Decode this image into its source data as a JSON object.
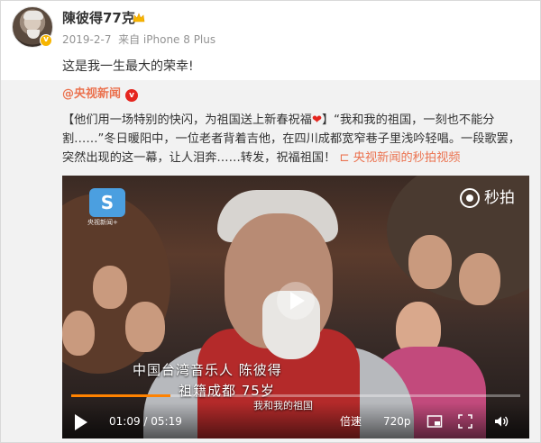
{
  "post": {
    "username": "陳彼得77克",
    "date": "2019-2-7",
    "source": "来自 iPhone 8 Plus",
    "text": "这是我一生最大的荣幸!",
    "badge_icon": "crown-icon",
    "verified_color": "#f7b500"
  },
  "repost": {
    "author": "@央视新闻",
    "verified_icon": "red-v-icon",
    "text_part1": "【他们用一场特别的快闪，为祖国送上新春祝福",
    "heart": "❤",
    "text_part2": "】“我和我的祖国，一刻也不能分割……”冬日暖阳中，一位老者背着吉他，在四川成都宽窄巷子里浅吟轻唱。一段歌罢，突然出现的这一幕，让人泪奔……转发，祝福祖国！",
    "link_icon": "video-link-icon",
    "link_text": "央视新闻的秒拍视频",
    "accent": "#eb7350"
  },
  "video": {
    "logo_text": "央视新闻+",
    "miaopai_label": "秒拍",
    "caption_line1": "中国台湾音乐人  陈彼得",
    "caption_line2": "祖籍成都  75岁",
    "subtitle": "我和我的祖国",
    "progress": 0.22,
    "time_current": "01:09",
    "time_total": "05:19",
    "time_display": "01:09 / 05:19",
    "speed_label": "倍速",
    "quality_label": "720p",
    "progress_color": "#ff8200"
  }
}
